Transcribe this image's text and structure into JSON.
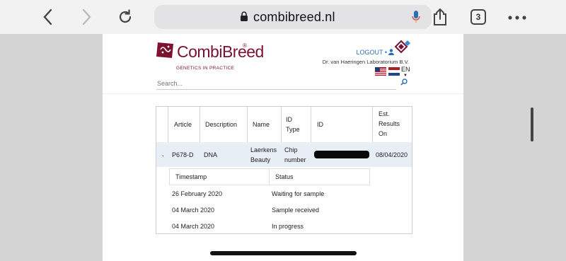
{
  "browser": {
    "url": "combibreed.nl",
    "tab_count": "3"
  },
  "header": {
    "brand": "CombiBreed",
    "reg": "®",
    "tagline": "GENETICS IN PRACTICE",
    "logout": "LOGOUT •",
    "lab": "Dr. van Haeringen Laboratorium B.V.",
    "lang": "EN",
    "search_placeholder": "Search..."
  },
  "table": {
    "headers": [
      "Article",
      "Description",
      "Name",
      "ID\nType",
      "ID",
      "Est.\nResults\nOn"
    ],
    "row": {
      "article": "P678-D",
      "description": "DNA",
      "name": "Laerkens\nBeauty",
      "id_type": "Chip\nnumber",
      "id": "",
      "est": "08/04/2020"
    },
    "sub_headers": [
      "Timestamp",
      "Status"
    ],
    "history": [
      {
        "timestamp": "26 February 2020",
        "status": "Waiting for sample"
      },
      {
        "timestamp": "04 March 2020",
        "status": "Sample received"
      },
      {
        "timestamp": "04 March 2020",
        "status": "In progress"
      }
    ]
  },
  "colors": {
    "brand": "#7a1230",
    "link": "#2a6fb5",
    "row_highlight": "#e8eef6"
  }
}
